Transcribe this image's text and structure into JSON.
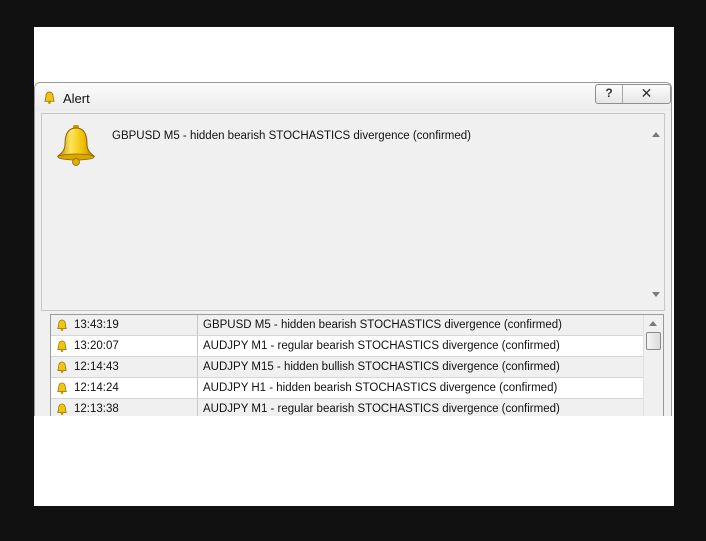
{
  "window": {
    "title": "Alert",
    "help_label": "?",
    "close_label": "✕"
  },
  "message": {
    "text": "GBPUSD M5 - hidden bearish STOCHASTICS divergence (confirmed)"
  },
  "alerts": [
    {
      "time": "13:43:19",
      "message": "GBPUSD M5 - hidden bearish STOCHASTICS divergence (confirmed)"
    },
    {
      "time": "13:20:07",
      "message": "AUDJPY M1 - regular bearish STOCHASTICS divergence (confirmed)"
    },
    {
      "time": "12:14:43",
      "message": "AUDJPY M15 - hidden bullish STOCHASTICS divergence (confirmed)"
    },
    {
      "time": "12:14:24",
      "message": "AUDJPY H1 - hidden bearish STOCHASTICS divergence (confirmed)"
    },
    {
      "time": "12:13:38",
      "message": "AUDJPY M1 - regular bearish STOCHASTICS divergence (confirmed)"
    }
  ],
  "icons": {
    "title": "bell-icon",
    "message": "bell-icon",
    "row": "bell-icon"
  },
  "colors": {
    "bell": "#e8b800",
    "selected_row": "#f0f0f0"
  }
}
